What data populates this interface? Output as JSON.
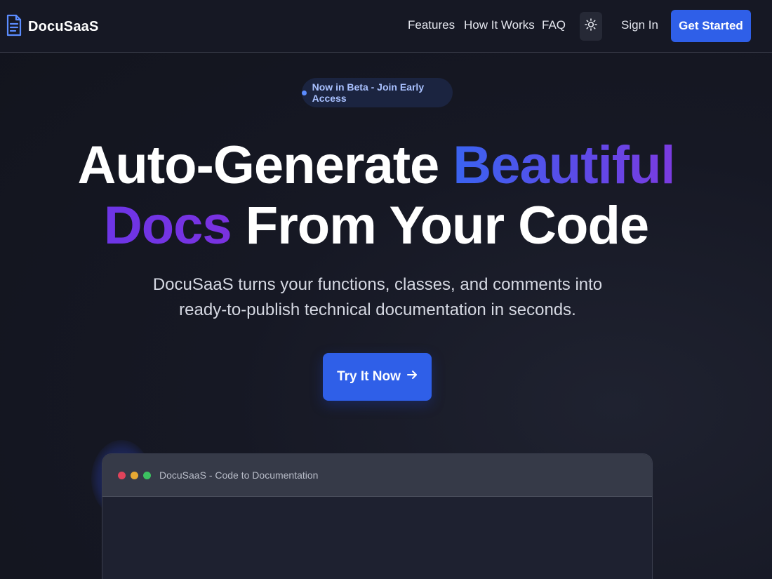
{
  "brand": {
    "name": "DocuSaaS",
    "logo_icon": "document-icon"
  },
  "nav": {
    "links": [
      "Features",
      "How It Works",
      "FAQ"
    ],
    "theme_toggle_icon": "sun-icon",
    "sign_in": "Sign In",
    "get_started": "Get Started"
  },
  "badge": {
    "text": "Now in Beta - Join Early Access"
  },
  "hero": {
    "line1_plain": "Auto-Generate ",
    "line1_accent": "Beautiful",
    "line2_accent": "Docs",
    "line2_plain": " From Your Code",
    "subtitle": "DocuSaaS turns your functions, classes, and comments into ready-to-publish technical documentation in seconds.",
    "cta": "Try It Now"
  },
  "window": {
    "title": "DocuSaaS - Code to Documentation",
    "dots": [
      "#e0435b",
      "#e6a833",
      "#3cc261"
    ]
  },
  "colors": {
    "accent_blue": "#2f5fe8",
    "background": "#13151f",
    "gradient_start": "#3a63f0",
    "gradient_end": "#7b3be0"
  }
}
